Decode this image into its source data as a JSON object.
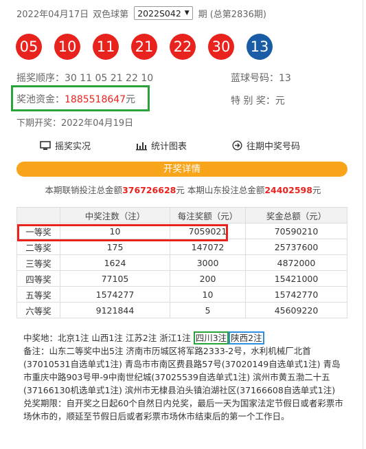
{
  "header": {
    "date": "2022年04月17日",
    "game": "双色球第",
    "issue_selected": "2022S042",
    "issue_suffix": "期",
    "total_issue": "(总第2836期)"
  },
  "balls": {
    "red": [
      "05",
      "10",
      "11",
      "21",
      "22",
      "30"
    ],
    "blue": "13"
  },
  "info": {
    "order": "摇奖顺序：30 11 05 21 22 10",
    "blue_label": "蓝球号码：13",
    "jackpot_label": "奖池资金：",
    "jackpot_value": "1885518647",
    "jackpot_unit": "元",
    "special_prize": "特 别 奖：元",
    "next_draw": "下期开奖：2022年04月19日"
  },
  "links": {
    "video": "摇奖实况",
    "chart": "统计图表",
    "history": "往期中奖号码"
  },
  "detail_bar": "开奖详情",
  "sales": {
    "prefix": "本期联销投注总金额",
    "national": "376726628",
    "mid": "元 本期山东投注总金额",
    "local": "24402598",
    "suffix": "元"
  },
  "table": {
    "headers": [
      "",
      "中奖注数（注）",
      "每注奖额（元）",
      "奖金总额（元）"
    ],
    "rows": [
      [
        "一等奖",
        "10",
        "7059021",
        "70590210"
      ],
      [
        "二等奖",
        "175",
        "147072",
        "25737600"
      ],
      [
        "三等奖",
        "1624",
        "3000",
        "4872000"
      ],
      [
        "四等奖",
        "77105",
        "200",
        "15421000"
      ],
      [
        "五等奖",
        "1574277",
        "10",
        "15742770"
      ],
      [
        "六等奖",
        "9121844",
        "5",
        "45609220"
      ]
    ]
  },
  "notes": {
    "winners_prefix": "中奖地：北京1注 山西1注 江苏2注 浙江1注",
    "winners_sichuan": "四川3注",
    "winners_shaanxi": "陕西2注",
    "remark": "备注：山东二等奖中出5注 济南市历城区将军路2333-2号，水利机械厂北首(37010531自选单式1注) 青岛市市南区费县路57号(37020149自选单式1注) 青岛市重庆中路903号甲-9中南世纪城(37025539自选单式1注) 滨州市黄五渤二十五(37166130机选单式1注) 滨州市无棣县泊头镇泊湖社区(37166608自选单式1注)",
    "claim": "兑奖期限：自开奖之日起60个自然日内兑奖，最后一天为国家法定节假日或者彩票市场休市的，顺延至节假日后或者彩票市场休市结束后的第一个工作日。"
  },
  "colors": {
    "red_ball": "#e8231e",
    "blue_ball": "#1a5ca6",
    "accent_orange": "#f8a51c",
    "highlight_green": "#27a33a",
    "highlight_blue": "#2c8fe0"
  }
}
